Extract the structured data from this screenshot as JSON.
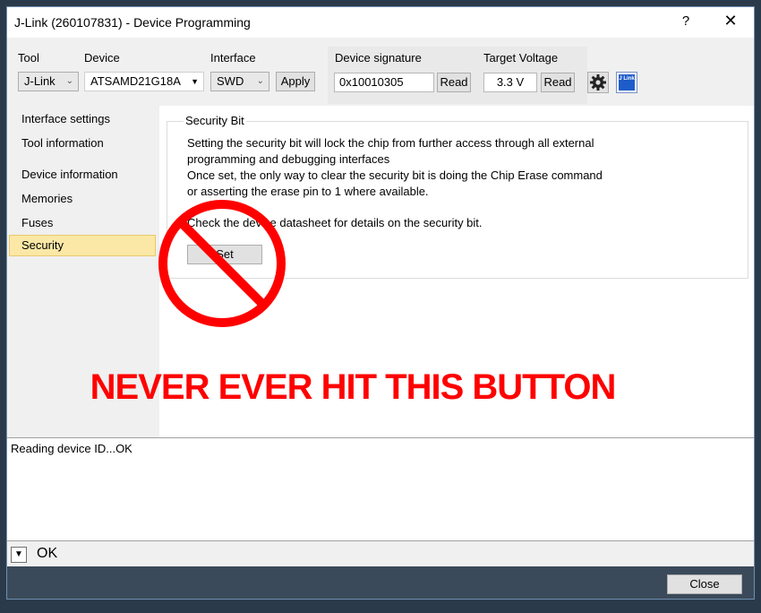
{
  "window": {
    "title": "J-Link (260107831) - Device Programming",
    "help_label": "?",
    "close_label": "✕"
  },
  "toolbar": {
    "tool_label": "Tool",
    "tool_value": "J-Link",
    "device_label": "Device",
    "device_value": "ATSAMD21G18A",
    "interface_label": "Interface",
    "interface_value": "SWD",
    "apply_label": "Apply",
    "signature_label": "Device signature",
    "signature_value": "0x10010305",
    "signature_read_label": "Read",
    "voltage_label": "Target Voltage",
    "voltage_value": "3.3 V",
    "voltage_read_label": "Read",
    "jlink_icon_text": "J Link"
  },
  "sidebar": {
    "items": [
      {
        "label": "Interface settings"
      },
      {
        "label": "Tool information"
      },
      {
        "label": "Device information"
      },
      {
        "label": "Memories"
      },
      {
        "label": "Fuses"
      },
      {
        "label": "Security"
      }
    ],
    "selected": "Security"
  },
  "security": {
    "group_title": "Security Bit",
    "line1": "Setting the security bit will lock the chip from further access through all external",
    "line2": "programming and debugging interfaces",
    "line3": "Once set, the only way to clear the security bit is doing the Chip Erase command",
    "line4": "or asserting the erase pin to 1 where available.",
    "line5": "Check the device datasheet for details on the security bit.",
    "set_label": "Set"
  },
  "overlay": {
    "warning_text": "NEVER EVER HIT THIS BUTTON",
    "warning_color": "#ff0000"
  },
  "log": {
    "text": "Reading device ID...OK"
  },
  "status": {
    "text": "OK"
  },
  "footer": {
    "close_label": "Close"
  }
}
